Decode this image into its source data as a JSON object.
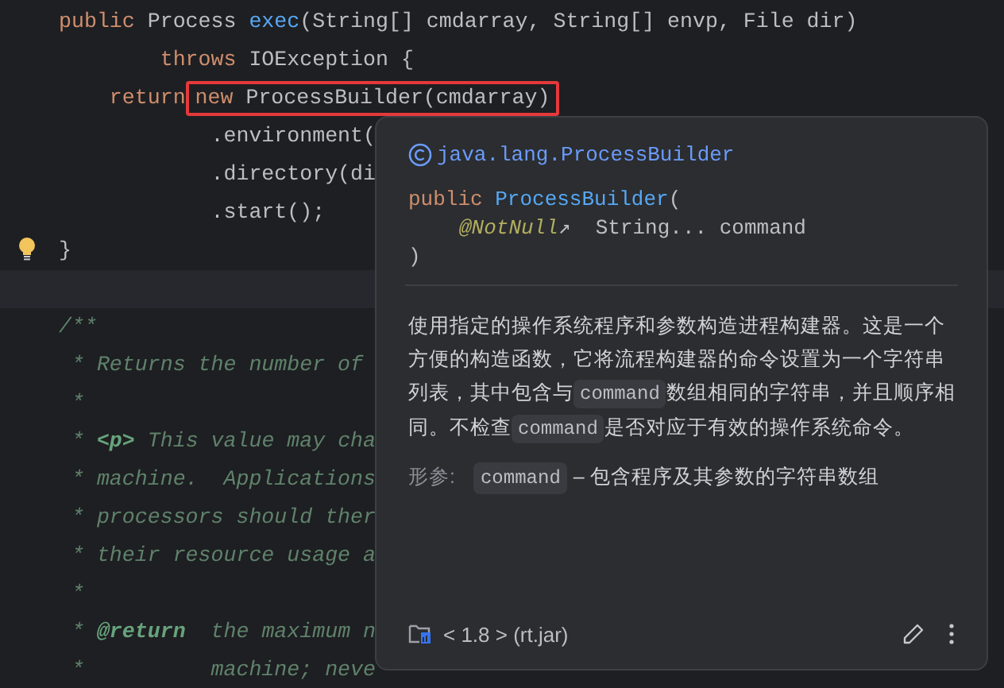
{
  "editor": {
    "lines": [
      {
        "tokens": [
          {
            "t": "public ",
            "kind": "keyword"
          },
          {
            "t": "Process ",
            "kind": "plain"
          },
          {
            "t": "exec",
            "kind": "method"
          },
          {
            "t": "(String[] cmdarray, String[] envp, File dir)",
            "kind": "plain"
          }
        ]
      },
      {
        "tokens": [
          {
            "t": "        throws ",
            "kind": "keyword"
          },
          {
            "t": "IOException {",
            "kind": "plain"
          }
        ]
      },
      {
        "tokens": [
          {
            "t": "    return",
            "kind": "keyword"
          }
        ],
        "highlight": [
          {
            "t": "new ",
            "kind": "keyword"
          },
          {
            "t": "ProcessBuilder(cmdarray)",
            "kind": "plain"
          }
        ]
      },
      {
        "tokens": [
          {
            "t": "            .environment(",
            "kind": "plain"
          }
        ]
      },
      {
        "tokens": [
          {
            "t": "            .directory(di",
            "kind": "plain"
          }
        ]
      },
      {
        "tokens": [
          {
            "t": "            .start();",
            "kind": "plain"
          }
        ]
      },
      {
        "tokens": [
          {
            "t": "}",
            "kind": "plain"
          }
        ],
        "lightbulb": true
      },
      {
        "current": true
      },
      {
        "tokens": [
          {
            "t": "/**",
            "kind": "doc"
          }
        ]
      },
      {
        "tokens": [
          {
            "t": " * Returns the number of",
            "kind": "doc"
          }
        ]
      },
      {
        "tokens": [
          {
            "t": " *",
            "kind": "doc"
          }
        ]
      },
      {
        "tokens": [
          {
            "t": " * ",
            "kind": "doc"
          },
          {
            "t": "<p>",
            "kind": "doctag"
          },
          {
            "t": " This value may cha",
            "kind": "doc"
          }
        ]
      },
      {
        "tokens": [
          {
            "t": " * machine.  Applications",
            "kind": "doc"
          }
        ]
      },
      {
        "tokens": [
          {
            "t": " * processors should ther",
            "kind": "doc"
          }
        ]
      },
      {
        "tokens": [
          {
            "t": " * their resource usage a",
            "kind": "doc"
          }
        ]
      },
      {
        "tokens": [
          {
            "t": " *",
            "kind": "doc"
          }
        ]
      },
      {
        "tokens": [
          {
            "t": " * ",
            "kind": "doc"
          },
          {
            "t": "@return",
            "kind": "doctag"
          },
          {
            "t": "  the maximum n",
            "kind": "doc"
          }
        ]
      },
      {
        "tokens": [
          {
            "t": " *          machine; neve",
            "kind": "doc"
          }
        ]
      }
    ]
  },
  "popup": {
    "qualified_name": "java.lang.ProcessBuilder",
    "signature": [
      [
        {
          "t": "public ",
          "kind": "keyword"
        },
        {
          "t": "ProcessBuilder",
          "kind": "method"
        },
        {
          "t": "(",
          "kind": "plain"
        }
      ],
      [
        {
          "t": "@NotNull",
          "kind": "annotation"
        },
        {
          "t": "↗",
          "kind": "plain"
        },
        {
          "t": "  String... command",
          "kind": "plain"
        }
      ],
      [
        {
          "t": ")",
          "kind": "plain"
        }
      ]
    ],
    "description": [
      {
        "t": "使用指定的操作系统程序和参数构造进程构建器。这是一个方便的构造函数，它将流程构建器的命令设置为一个字符串列表，其中包含与"
      },
      {
        "code": "command"
      },
      {
        "t": "数组相同的字符串，并且顺序相同。不检查"
      },
      {
        "code": "command"
      },
      {
        "t": "是否对应于有效的操作系统命令。"
      }
    ],
    "params_label": "形参:",
    "params": [
      {
        "name": "command",
        "description": "– 包含程序及其参数的字符串数组"
      }
    ],
    "footer": {
      "library": "< 1.8 > (rt.jar)"
    }
  }
}
